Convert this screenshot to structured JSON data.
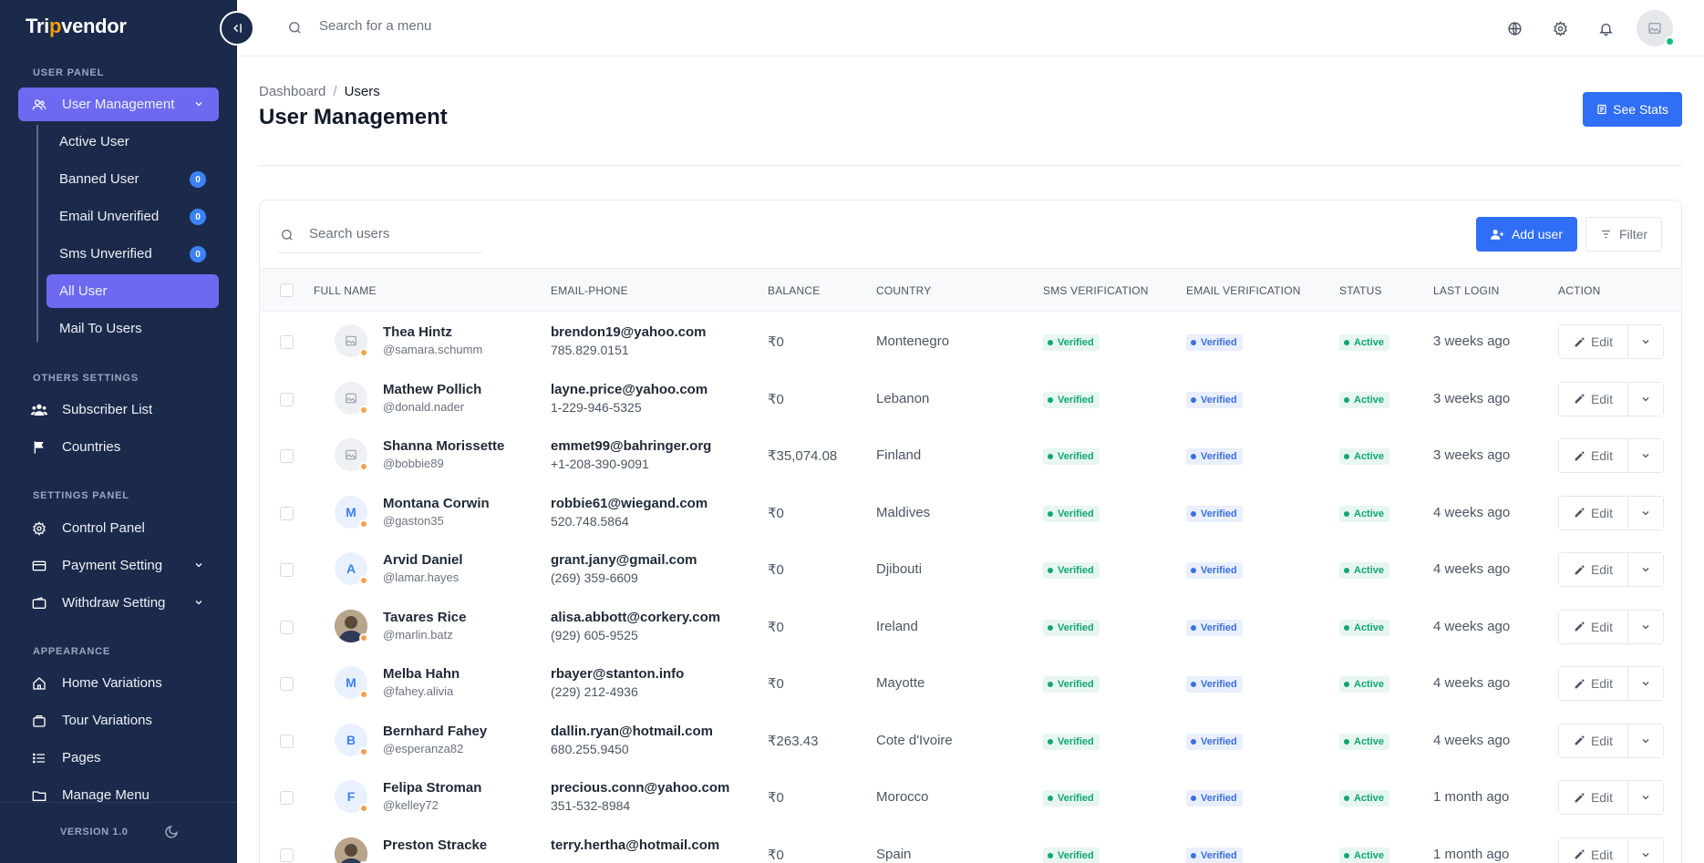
{
  "brand": {
    "logo_pre": "Tri",
    "logo_o": "p",
    "logo_post": "vendor"
  },
  "sidebar": {
    "sections": [
      {
        "label": "USER PANEL"
      },
      {
        "label": "OTHERS SETTINGS"
      },
      {
        "label": "SETTINGS PANEL"
      },
      {
        "label": "APPEARANCE"
      }
    ],
    "user_management": "User Management",
    "sub_items": [
      {
        "label": "Active User"
      },
      {
        "label": "Banned User",
        "badge": "0"
      },
      {
        "label": "Email Unverified",
        "badge": "0"
      },
      {
        "label": "Sms Unverified",
        "badge": "0"
      },
      {
        "label": "All User"
      },
      {
        "label": "Mail To Users"
      }
    ],
    "others": [
      {
        "label": "Subscriber List",
        "icon": "users-icon"
      },
      {
        "label": "Countries",
        "icon": "flag-icon"
      }
    ],
    "settings": [
      {
        "label": "Control Panel",
        "icon": "gear-icon"
      },
      {
        "label": "Payment Setting",
        "icon": "card-icon"
      },
      {
        "label": "Withdraw Setting",
        "icon": "wallet-icon"
      }
    ],
    "appearance": [
      {
        "label": "Home Variations",
        "icon": "home-icon"
      },
      {
        "label": "Tour Variations",
        "icon": "bag-icon"
      },
      {
        "label": "Pages",
        "icon": "list-icon"
      },
      {
        "label": "Manage Menu",
        "icon": "folder-icon"
      }
    ],
    "version": "VERSION 1.0"
  },
  "topbar": {
    "search_placeholder": "Search for a menu"
  },
  "page": {
    "breadcrumb_root": "Dashboard",
    "breadcrumb_sep": "/",
    "breadcrumb_current": "Users",
    "title": "User Management",
    "see_stats": "See Stats"
  },
  "table": {
    "search_placeholder": "Search users",
    "add_user": "Add user",
    "filter": "Filter",
    "columns": [
      "FULL NAME",
      "EMAIL-PHONE",
      "BALANCE",
      "COUNTRY",
      "SMS VERIFICATION",
      "EMAIL VERIFICATION",
      "STATUS",
      "LAST LOGIN",
      "ACTION"
    ],
    "edit_label": "Edit",
    "rows": [
      {
        "name": "Thea Hintz",
        "username": "@samara.schumm",
        "email": "brendon19@yahoo.com",
        "phone": "785.829.0151",
        "balance": "₹0",
        "country": "Montenegro",
        "sms": "Verified",
        "email_v": "Verified",
        "status": "Active",
        "last_login": "3 weeks ago",
        "avatar": "image",
        "initial": ""
      },
      {
        "name": "Mathew Pollich",
        "username": "@donald.nader",
        "email": "layne.price@yahoo.com",
        "phone": "1-229-946-5325",
        "balance": "₹0",
        "country": "Lebanon",
        "sms": "Verified",
        "email_v": "Verified",
        "status": "Active",
        "last_login": "3 weeks ago",
        "avatar": "image",
        "initial": ""
      },
      {
        "name": "Shanna Morissette",
        "username": "@bobbie89",
        "email": "emmet99@bahringer.org",
        "phone": "+1-208-390-9091",
        "balance": "₹35,074.08",
        "country": "Finland",
        "sms": "Verified",
        "email_v": "Verified",
        "status": "Active",
        "last_login": "3 weeks ago",
        "avatar": "image",
        "initial": ""
      },
      {
        "name": "Montana Corwin",
        "username": "@gaston35",
        "email": "robbie61@wiegand.com",
        "phone": "520.748.5864",
        "balance": "₹0",
        "country": "Maldives",
        "sms": "Verified",
        "email_v": "Verified",
        "status": "Active",
        "last_login": "4 weeks ago",
        "avatar": "letter",
        "initial": "M"
      },
      {
        "name": "Arvid Daniel",
        "username": "@lamar.hayes",
        "email": "grant.jany@gmail.com",
        "phone": "(269) 359-6609",
        "balance": "₹0",
        "country": "Djibouti",
        "sms": "Verified",
        "email_v": "Verified",
        "status": "Active",
        "last_login": "4 weeks ago",
        "avatar": "letter",
        "initial": "A"
      },
      {
        "name": "Tavares Rice",
        "username": "@marlin.batz",
        "email": "alisa.abbott@corkery.com",
        "phone": "(929) 605-9525",
        "balance": "₹0",
        "country": "Ireland",
        "sms": "Verified",
        "email_v": "Verified",
        "status": "Active",
        "last_login": "4 weeks ago",
        "avatar": "photo",
        "initial": ""
      },
      {
        "name": "Melba Hahn",
        "username": "@fahey.alivia",
        "email": "rbayer@stanton.info",
        "phone": "(229) 212-4936",
        "balance": "₹0",
        "country": "Mayotte",
        "sms": "Verified",
        "email_v": "Verified",
        "status": "Active",
        "last_login": "4 weeks ago",
        "avatar": "letter",
        "initial": "M"
      },
      {
        "name": "Bernhard Fahey",
        "username": "@esperanza82",
        "email": "dallin.ryan@hotmail.com",
        "phone": "680.255.9450",
        "balance": "₹263.43",
        "country": "Cote d'Ivoire",
        "sms": "Verified",
        "email_v": "Verified",
        "status": "Active",
        "last_login": "4 weeks ago",
        "avatar": "letter",
        "initial": "B"
      },
      {
        "name": "Felipa Stroman",
        "username": "@kelley72",
        "email": "precious.conn@yahoo.com",
        "phone": "351-532-8984",
        "balance": "₹0",
        "country": "Morocco",
        "sms": "Verified",
        "email_v": "Verified",
        "status": "Active",
        "last_login": "1 month ago",
        "avatar": "letter",
        "initial": "F"
      },
      {
        "name": "Preston Stracke",
        "username": "",
        "email": "terry.hertha@hotmail.com",
        "phone": "",
        "balance": "₹0",
        "country": "Spain",
        "sms": "Verified",
        "email_v": "Verified",
        "status": "Active",
        "last_login": "1 month ago",
        "avatar": "photo",
        "initial": ""
      }
    ]
  },
  "colors": {
    "sidebar_bg": "#1b2a4a",
    "active_item": "#6d6af1",
    "primary": "#2f6ef5",
    "success": "#10a76f"
  }
}
